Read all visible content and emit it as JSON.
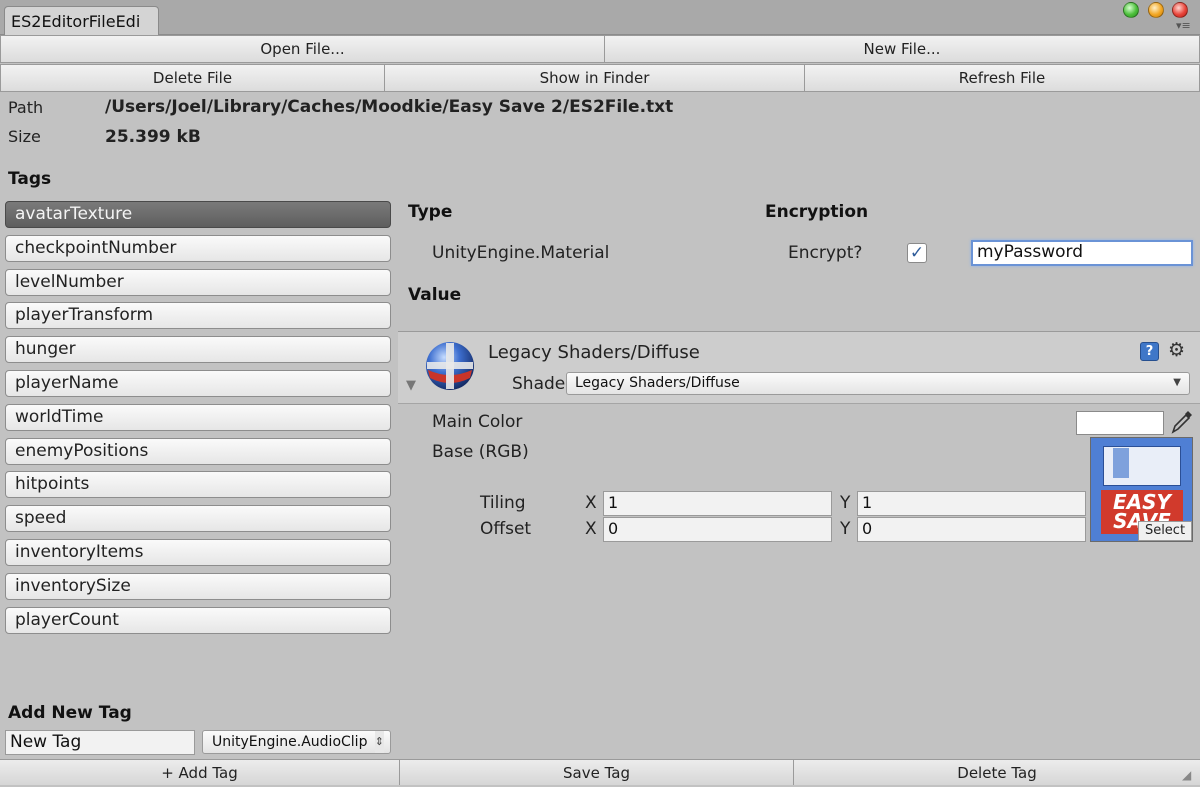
{
  "window": {
    "tab_title": "ES2EditorFileEdi",
    "menu_icon": "menu-icon"
  },
  "toolbar": {
    "open_file": "Open File...",
    "new_file": "New File...",
    "delete_file": "Delete File",
    "show_in_finder": "Show in Finder",
    "refresh_file": "Refresh File"
  },
  "file": {
    "path_label": "Path",
    "path_value": "/Users/Joel/Library/Caches/Moodkie/Easy Save 2/ES2File.txt",
    "size_label": "Size",
    "size_value": "25.399 kB"
  },
  "tags": {
    "heading": "Tags",
    "selected_index": 0,
    "items": [
      "avatarTexture",
      "checkpointNumber",
      "levelNumber",
      "playerTransform",
      "hunger",
      "playerName",
      "worldTime",
      "enemyPositions",
      "hitpoints",
      "speed",
      "inventoryItems",
      "inventorySize",
      "playerCount"
    ]
  },
  "details": {
    "type_heading": "Type",
    "type_value": "UnityEngine.Material",
    "encryption_heading": "Encryption",
    "encrypt_label": "Encrypt?",
    "encrypt_checked": true,
    "password": "myPassword",
    "value_heading": "Value"
  },
  "material": {
    "name": "Legacy Shaders/Diffuse",
    "shader_label": "Shade",
    "shader_value": "Legacy Shaders/Diffuse",
    "main_color_label": "Main Color",
    "base_label": "Base (RGB)",
    "tiling_label": "Tiling",
    "offset_label": "Offset",
    "x_label": "X",
    "y_label": "Y",
    "tiling_x": "1",
    "tiling_y": "1",
    "offset_x": "0",
    "offset_y": "0",
    "texture_text": "EASY SAVE",
    "select_label": "Select"
  },
  "add_tag": {
    "heading": "Add New Tag",
    "name_value": "New Tag",
    "type_value": "UnityEngine.AudioClip"
  },
  "bottom": {
    "add_tag": "+ Add Tag",
    "save_tag": "Save Tag",
    "delete_tag": "Delete Tag"
  }
}
